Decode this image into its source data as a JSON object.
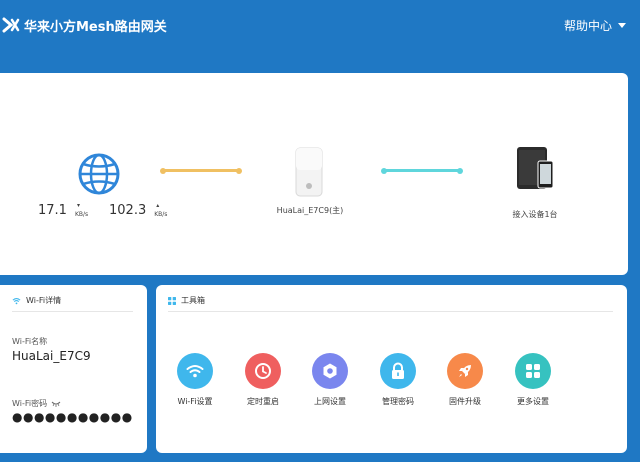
{
  "header": {
    "title": "华来小方Mesh路由网关",
    "help_label": "帮助中心"
  },
  "topology": {
    "download_speed": "17.1",
    "upload_speed": "102.3",
    "speed_unit": "KB/s",
    "router_name": "HuaLai_E7C9(主)",
    "devices_label": "接入设备1台",
    "colors": {
      "wan_link": "#f0c062",
      "lan_link": "#5fd6dc",
      "globe": "#2f86d9"
    }
  },
  "wifi": {
    "title": "Wi-Fi详情",
    "ssid_label": "Wi-Fi名称",
    "ssid": "HuaLai_E7C9",
    "password_label": "Wi-Fi密码",
    "password": "●●●●●●●●●●●"
  },
  "tools": {
    "title": "工具箱",
    "items": [
      {
        "label": "Wi-Fi设置",
        "icon": "wifi-icon",
        "color": "#3fb7ec"
      },
      {
        "label": "定时重启",
        "icon": "clock-icon",
        "color": "#ef5f5f"
      },
      {
        "label": "上网设置",
        "icon": "settings-icon",
        "color": "#7a86ee"
      },
      {
        "label": "管理密码",
        "icon": "lock-icon",
        "color": "#3fb7ec"
      },
      {
        "label": "固件升级",
        "icon": "rocket-icon",
        "color": "#f7894a"
      },
      {
        "label": "更多设置",
        "icon": "grid-icon",
        "color": "#36c2c0"
      }
    ]
  }
}
